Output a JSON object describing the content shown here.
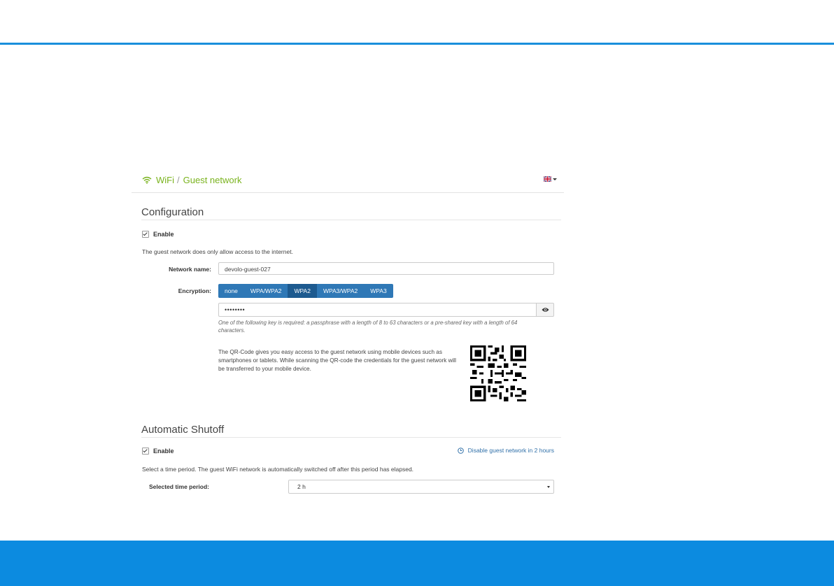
{
  "breadcrumb": {
    "root": "WiFi",
    "separator": "/",
    "current": "Guest network",
    "icon": "wifi-icon"
  },
  "language": {
    "icon": "uk-flag-icon"
  },
  "configuration": {
    "title": "Configuration",
    "enable_label": "Enable",
    "enabled": true,
    "info": "The guest network does only allow access to the internet.",
    "network_name_label": "Network name:",
    "network_name_value": "devolo-guest-027",
    "encryption_label": "Encryption:",
    "encryption_options": [
      "none",
      "WPA/WPA2",
      "WPA2",
      "WPA3/WPA2",
      "WPA3"
    ],
    "encryption_selected": "WPA2",
    "password_mask": "••••••••",
    "password_help": "One of the following key is required: a passphrase with a length of 8 to 63 characters or a pre-shared key with a length of 64 characters.",
    "qr_text": "The QR-Code gives you easy access to the guest network using mobile devices such as smartphones or tablets. While scanning the QR-code the credentials for the guest network will be transferred to your mobile device."
  },
  "shutoff": {
    "title": "Automatic Shutoff",
    "enable_label": "Enable",
    "enabled": true,
    "timer_link": "Disable guest network in 2 hours",
    "info": "Select a time period. The guest WiFi network is automatically switched off after this period has elapsed.",
    "period_label": "Selected time period:",
    "period_value": "2 h"
  },
  "colors": {
    "accent_blue": "#0c8be0",
    "breadcrumb_green": "#7ab31e",
    "button_blue": "#2f78b6",
    "button_active": "#1d5a8f"
  }
}
